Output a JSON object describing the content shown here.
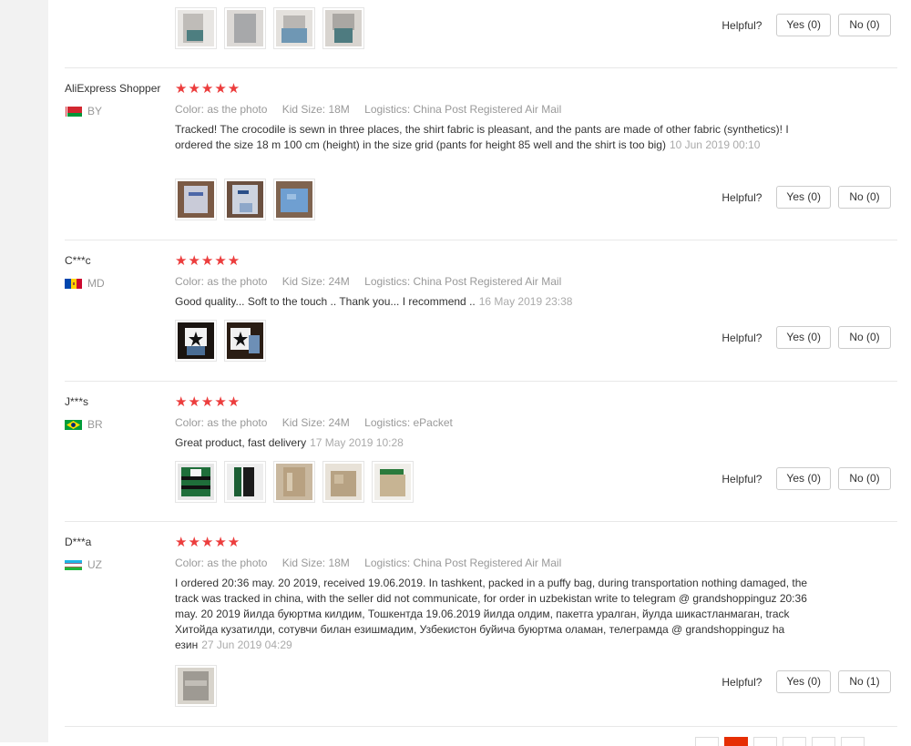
{
  "helpful_label": "Helpful?",
  "reviews": [
    {
      "yes": "Yes (0)",
      "no": "No (0)"
    },
    {
      "user": "AliExpress Shopper",
      "country": "BY",
      "stars": "★★★★★",
      "color": "Color: as the photo",
      "size": "Kid Size: 18M",
      "logistics": "Logistics: China Post Registered Air Mail",
      "text": "Tracked! The crocodile is sewn in three places, the shirt fabric is pleasant, and the pants are made of other fabric (synthetics)! I ordered the size 18 m 100 cm (height) in the size grid (pants for height 85 well and the shirt is too big)",
      "date": "10 Jun 2019 00:10",
      "yes": "Yes (0)",
      "no": "No (0)"
    },
    {
      "user": "C***c",
      "country": "MD",
      "stars": "★★★★★",
      "color": "Color: as the photo",
      "size": "Kid Size: 24M",
      "logistics": "Logistics: China Post Registered Air Mail",
      "text": "Good quality... Soft to the touch .. Thank you... I recommend ..",
      "date": "16 May 2019 23:38",
      "yes": "Yes (0)",
      "no": "No (0)"
    },
    {
      "user": "J***s",
      "country": "BR",
      "stars": "★★★★★",
      "color": "Color: as the photo",
      "size": "Kid Size: 24M",
      "logistics": "Logistics: ePacket",
      "text": "Great product, fast delivery",
      "date": "17 May 2019 10:28",
      "yes": "Yes (0)",
      "no": "No (0)"
    },
    {
      "user": "D***a",
      "country": "UZ",
      "stars": "★★★★★",
      "color": "Color: as the photo",
      "size": "Kid Size: 18M",
      "logistics": "Logistics: China Post Registered Air Mail",
      "text": "I ordered 20:36 may. 20 2019, received 19.06.2019. In tashkent, packed in a puffy bag, during transportation nothing damaged, the track was tracked in china, with the seller did not communicate, for order in uzbekistan write to telegram @ grandshoppinguz 20:36 may. 20 2019 йилда буюртма килдим, Тошкентда 19.06.2019 йилда олдим, пакетга уралган, йулда шикастланмаган, track Хитойда кузатилди, сотувчи билан езишмадим, Узбекистон буйича буюртма оламан, телеграмда @ grandshoppinguz ha езин",
      "date": "27 Jun 2019 04:29",
      "yes": "Yes (0)",
      "no": "No (1)"
    }
  ],
  "colors": {
    "star": "#ec3d3d",
    "pager_active": "#e62e04",
    "muted": "#999999"
  }
}
